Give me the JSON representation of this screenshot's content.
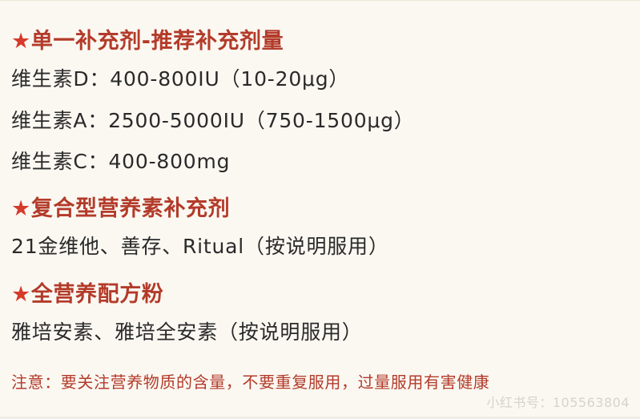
{
  "colors": {
    "background": "#fbf8f2",
    "heading": "#b33b2a",
    "body_text": "#2a2a2a",
    "note_text": "#b33b2a",
    "watermark": "#d8d2cb"
  },
  "icons": {
    "heading_marker": "star-icon"
  },
  "sections": [
    {
      "star": "★",
      "heading": "单一补充剂-推荐补充剂量",
      "items": [
        "维生素D：400-800IU（10-20μg）",
        "维生素A：2500-5000IU（750-1500μg）",
        "维生素C：400-800mg"
      ]
    },
    {
      "star": "★",
      "heading": "复合型营养素补充剂",
      "items": [
        "21金维他、善存、Ritual（按说明服用）"
      ]
    },
    {
      "star": "★",
      "heading": "全营养配方粉",
      "items": [
        "雅培安素、雅培全安素（按说明服用）"
      ]
    }
  ],
  "note": "注意：要关注营养物质的含量，不要重复服用，过量服用有害健康",
  "watermark": "小红书号：105563804"
}
